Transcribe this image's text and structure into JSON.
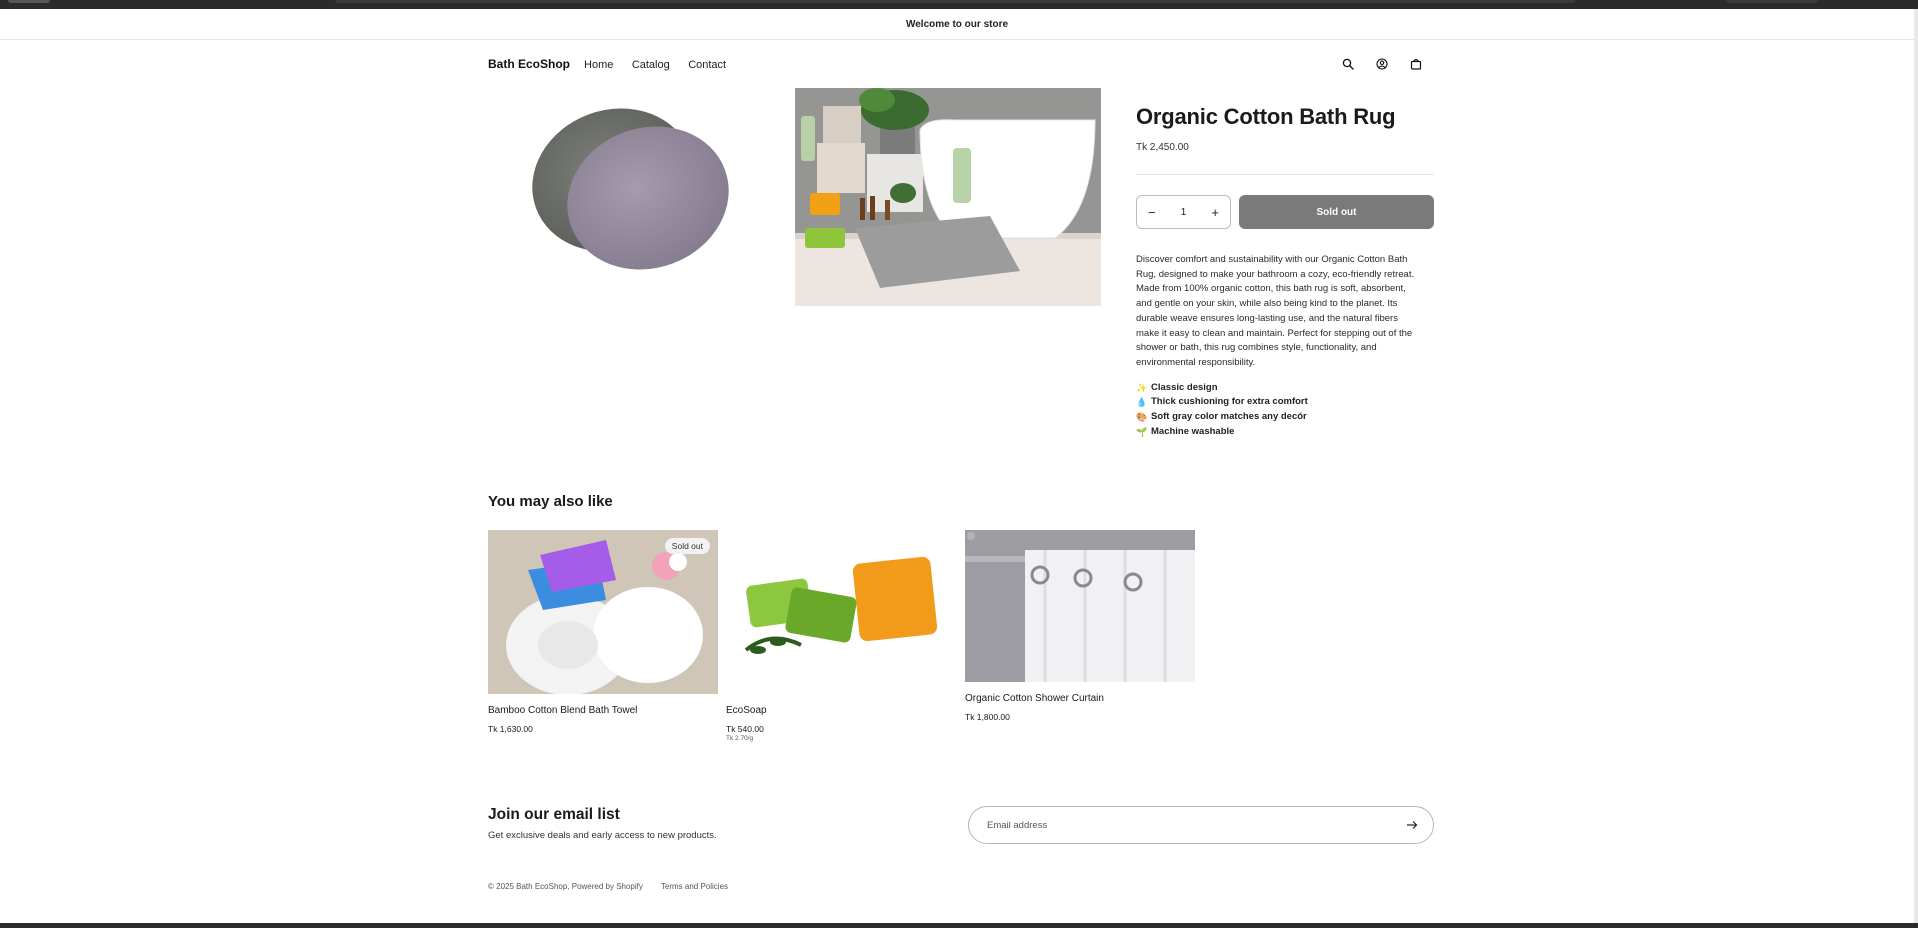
{
  "announcement": "Welcome to our store",
  "header": {
    "logo": "Bath EcoShop",
    "nav": [
      "Home",
      "Catalog",
      "Contact"
    ],
    "icons": [
      "search-icon",
      "account-icon",
      "cart-icon"
    ]
  },
  "product": {
    "title": "Organic Cotton Bath Rug",
    "price": "Tk 2,450.00",
    "quantity": "1",
    "sold_out_label": "Sold out",
    "description": "Discover comfort and sustainability with our Organic Cotton Bath Rug, designed to make your bathroom a cozy, eco-friendly retreat. Made from 100% organic cotton, this bath rug is soft, absorbent, and gentle on your skin, while also being kind to the planet. Its durable weave ensures long-lasting use, and the natural fibers make it easy to clean and maintain. Perfect for stepping out of the shower or bath, this rug combines style, functionality, and environmental responsibility.",
    "features": [
      {
        "emoji": "✨",
        "text": "Classic design"
      },
      {
        "emoji": "💧",
        "text": "Thick cushioning for extra comfort"
      },
      {
        "emoji": "🎨",
        "text": "Soft gray color matches any decór"
      },
      {
        "emoji": "🌱",
        "text": "Machine washable"
      }
    ]
  },
  "related": {
    "title": "You may also like",
    "items": [
      {
        "name": "Bamboo Cotton Blend Bath Towel",
        "price": "Tk 1,630.00",
        "badge": "Sold out"
      },
      {
        "name": "EcoSoap",
        "price": "Tk 540.00",
        "unit_price": "Tk 2.70/g"
      },
      {
        "name": "Organic Cotton Shower Curtain",
        "price": "Tk 1,800.00"
      }
    ]
  },
  "newsletter": {
    "heading": "Join our email list",
    "subtext": "Get exclusive deals and early access to new products.",
    "placeholder": "Email address"
  },
  "footer": {
    "copyright": "© 2025 Bath EcoShop, Powered by Shopify",
    "policies": "Terms and Policies"
  }
}
